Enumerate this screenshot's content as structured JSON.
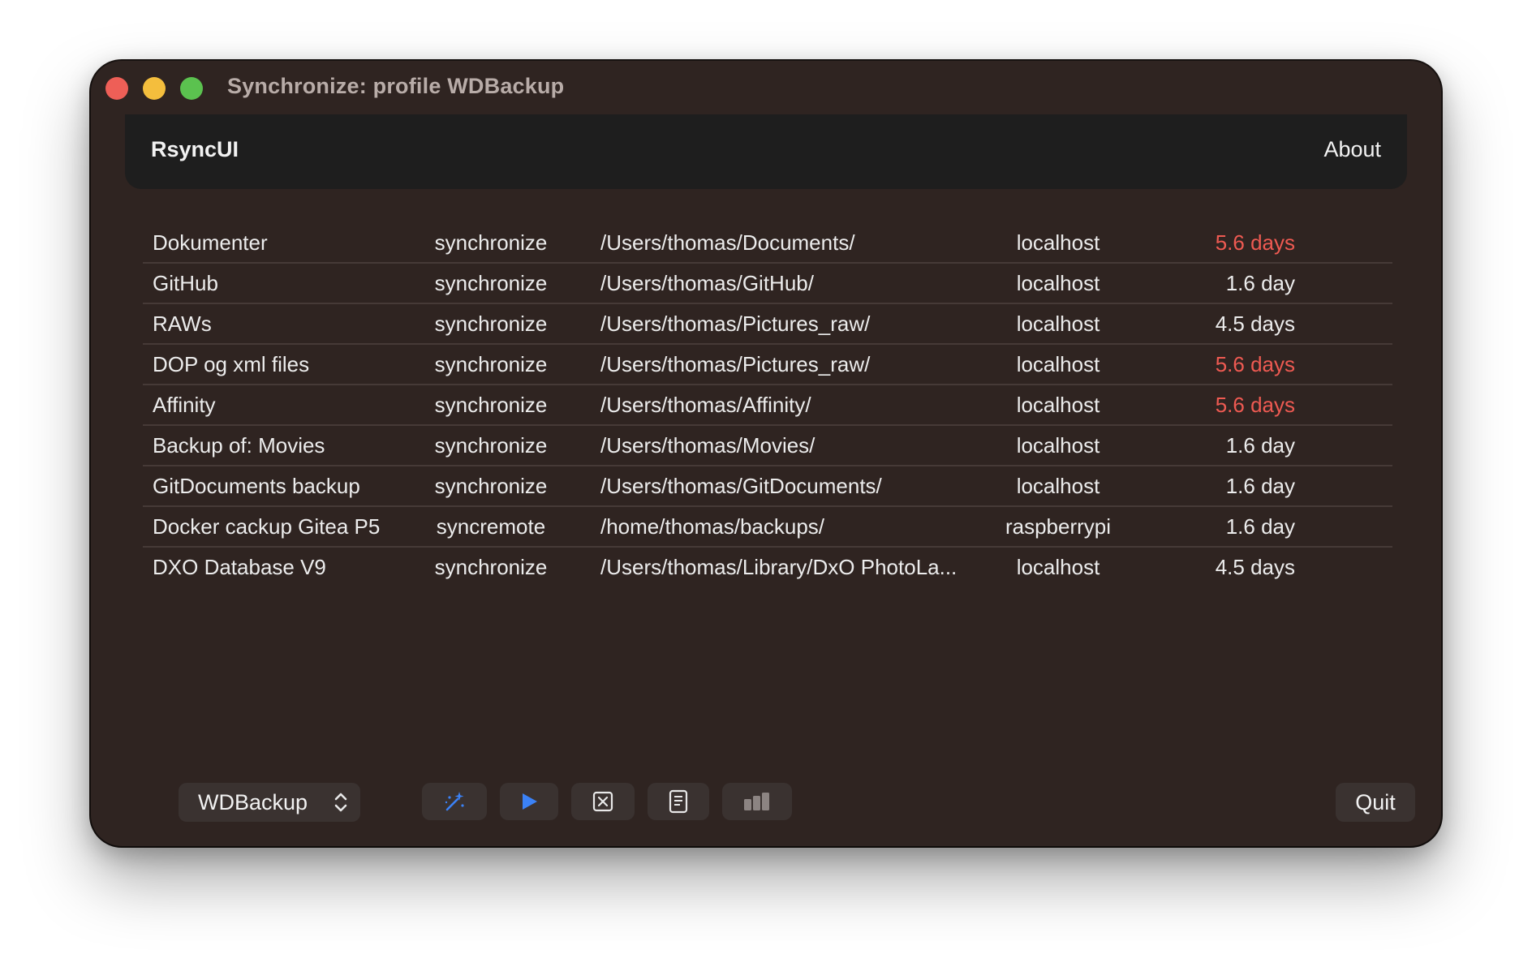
{
  "window": {
    "title": "Synchronize: profile WDBackup"
  },
  "navbar": {
    "app_name": "RsyncUI",
    "about_label": "About"
  },
  "tasks": [
    {
      "name": "Dokumenter",
      "task": "synchronize",
      "path": "/Users/thomas/Documents/",
      "host": "localhost",
      "days": "5.6 days",
      "overdue": true
    },
    {
      "name": "GitHub",
      "task": "synchronize",
      "path": "/Users/thomas/GitHub/",
      "host": "localhost",
      "days": "1.6 day",
      "overdue": false
    },
    {
      "name": "RAWs",
      "task": "synchronize",
      "path": "/Users/thomas/Pictures_raw/",
      "host": "localhost",
      "days": "4.5 days",
      "overdue": false
    },
    {
      "name": "DOP og xml files",
      "task": "synchronize",
      "path": "/Users/thomas/Pictures_raw/",
      "host": "localhost",
      "days": "5.6 days",
      "overdue": true
    },
    {
      "name": "Affinity",
      "task": "synchronize",
      "path": "/Users/thomas/Affinity/",
      "host": "localhost",
      "days": "5.6 days",
      "overdue": true
    },
    {
      "name": "Backup of: Movies",
      "task": "synchronize",
      "path": "/Users/thomas/Movies/",
      "host": "localhost",
      "days": "1.6 day",
      "overdue": false
    },
    {
      "name": "GitDocuments backup",
      "task": "synchronize",
      "path": "/Users/thomas/GitDocuments/",
      "host": "localhost",
      "days": "1.6 day",
      "overdue": false
    },
    {
      "name": "Docker cackup Gitea P5",
      "task": "syncremote",
      "path": "/home/thomas/backups/",
      "host": "raspberrypi",
      "days": "1.6 day",
      "overdue": false
    },
    {
      "name": "DXO Database V9",
      "task": "synchronize",
      "path": "/Users/thomas/Library/DxO PhotoLa...",
      "host": "localhost",
      "days": "4.5 days",
      "overdue": false
    }
  ],
  "toolbar": {
    "profile_value": "WDBackup",
    "quit_label": "Quit",
    "icons": [
      "magic-wand-icon",
      "play-icon",
      "abort-icon",
      "log-icon",
      "chart-icon"
    ]
  },
  "colors": {
    "overdue": "#ee5a52",
    "accent": "#3b82f6",
    "window_bg": "#2f2421"
  }
}
